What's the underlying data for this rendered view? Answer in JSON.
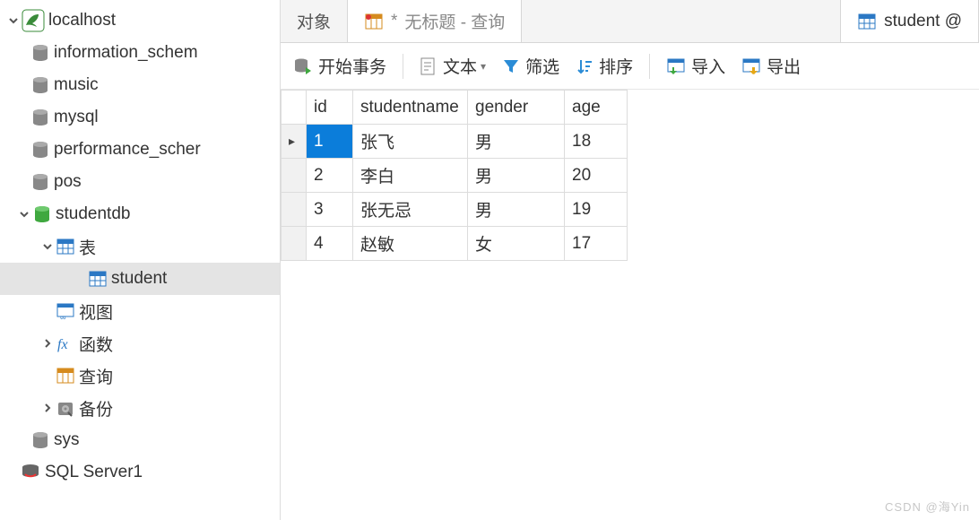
{
  "sidebar": {
    "connection": "localhost",
    "databases": [
      "information_schem",
      "music",
      "mysql",
      "performance_scher",
      "pos"
    ],
    "active_db": "studentdb",
    "folders": {
      "tables": "表",
      "views": "视图",
      "functions": "函数",
      "queries": "查询",
      "backups": "备份"
    },
    "selected_table": "student",
    "other_databases": [
      "sys"
    ],
    "other_connection": "SQL Server1"
  },
  "tabs": {
    "objects": "对象",
    "query_prefix": "*",
    "query_name": "无标题 - 查询",
    "table_tab": "student @"
  },
  "toolbar": {
    "begin_tx": "开始事务",
    "text": "文本",
    "filter": "筛选",
    "sort": "排序",
    "import": "导入",
    "export": "导出"
  },
  "table": {
    "columns": [
      "id",
      "studentname",
      "gender",
      "age"
    ],
    "rows": [
      {
        "id": 1,
        "studentname": "张飞",
        "gender": "男",
        "age": 18
      },
      {
        "id": 2,
        "studentname": "李白",
        "gender": "男",
        "age": 20
      },
      {
        "id": 3,
        "studentname": "张无忌",
        "gender": "男",
        "age": 19
      },
      {
        "id": 4,
        "studentname": "赵敏",
        "gender": "女",
        "age": 17
      }
    ],
    "selected_row_index": 0
  },
  "watermark": "CSDN @海Yin"
}
